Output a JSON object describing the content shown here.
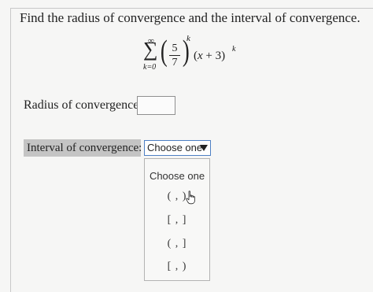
{
  "question": {
    "prompt": "Find the radius of convergence and the interval of convergence."
  },
  "formula": {
    "sum_symbol": "∑",
    "upper_limit": "∞",
    "lower_limit": "k=0",
    "fraction_numerator": "5",
    "fraction_denominator": "7",
    "fraction_exponent": "k",
    "open_paren": "(",
    "close_paren": ")",
    "term_open": "(",
    "term_var": "x",
    "term_rest": " + 3)",
    "term_exponent": "k"
  },
  "radius": {
    "label": "Radius of convergence:",
    "value": ""
  },
  "interval": {
    "label": "Interval of convergence:",
    "selected": "Choose one",
    "menu_header": "Choose one",
    "options": [
      "( , )",
      "[ , ]",
      "( , ]",
      "[ , )"
    ]
  },
  "icons": {
    "dropdown_arrow": "triangle-down-icon",
    "cursor": "hand-pointer-icon"
  },
  "colors": {
    "select_border": "#4d7fc4",
    "label_highlight": "#c4c4c4"
  }
}
